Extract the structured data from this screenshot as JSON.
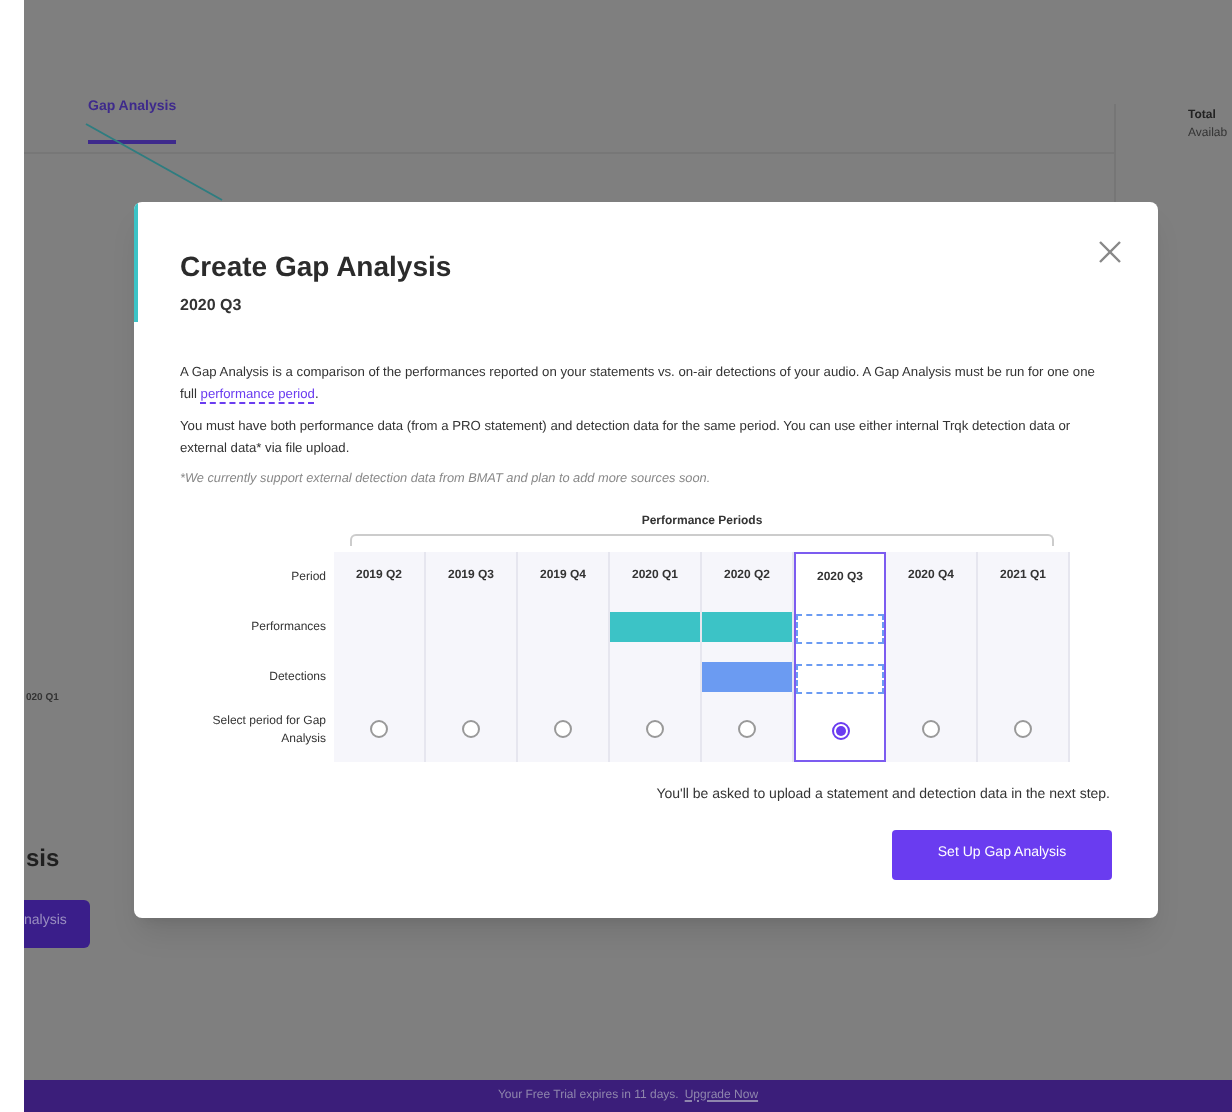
{
  "background": {
    "tab": {
      "label": "Gap Analysis",
      "selected": true
    },
    "total_heading": "Total",
    "total_sub": "Availab",
    "axis_label": "020 Q1",
    "section_title": "sis",
    "button": "nalysis"
  },
  "modal": {
    "title": "Create Gap Analysis",
    "subtitle": "2020 Q3",
    "intro": "A Gap Analysis is a comparison of the performances reported on your statements vs. on-air detections of your audio. A Gap Analysis must be run for one one full",
    "intro_link": "performance period",
    "intro_end": ".",
    "requirements": "You must have both performance data (from a PRO statement) and detection data for the same period. You can use either internal Trqk detection data or external data* via file upload.",
    "footnote": "*We currently support external detection data from BMAT and plan to add more sources soon.",
    "table": {
      "group_heading": "Performance Periods",
      "row_labels": [
        "Period",
        "Performances",
        "Detections",
        "Select period for Gap Analysis"
      ],
      "periods": [
        {
          "label": "2019 Q2",
          "performances": false,
          "detections": false,
          "selected": false
        },
        {
          "label": "2019 Q3",
          "performances": false,
          "detections": false,
          "selected": false
        },
        {
          "label": "2019 Q4",
          "performances": false,
          "detections": false,
          "selected": false
        },
        {
          "label": "2020 Q1",
          "performances": true,
          "detections": false,
          "selected": false
        },
        {
          "label": "2020 Q2",
          "performances": true,
          "detections": true,
          "selected": false
        },
        {
          "label": "2020 Q3",
          "performances": false,
          "detections": false,
          "selected": true
        },
        {
          "label": "2020 Q4",
          "performances": false,
          "detections": false,
          "selected": false
        },
        {
          "label": "2021 Q1",
          "performances": false,
          "detections": false,
          "selected": false
        }
      ]
    },
    "note": "You'll be asked to upload a statement and detection data in the next step.",
    "button": "Set Up Gap Analysis"
  },
  "banner": {
    "text": "Your Free Trial expires in 11 days.",
    "link": "Upgrade Now"
  }
}
